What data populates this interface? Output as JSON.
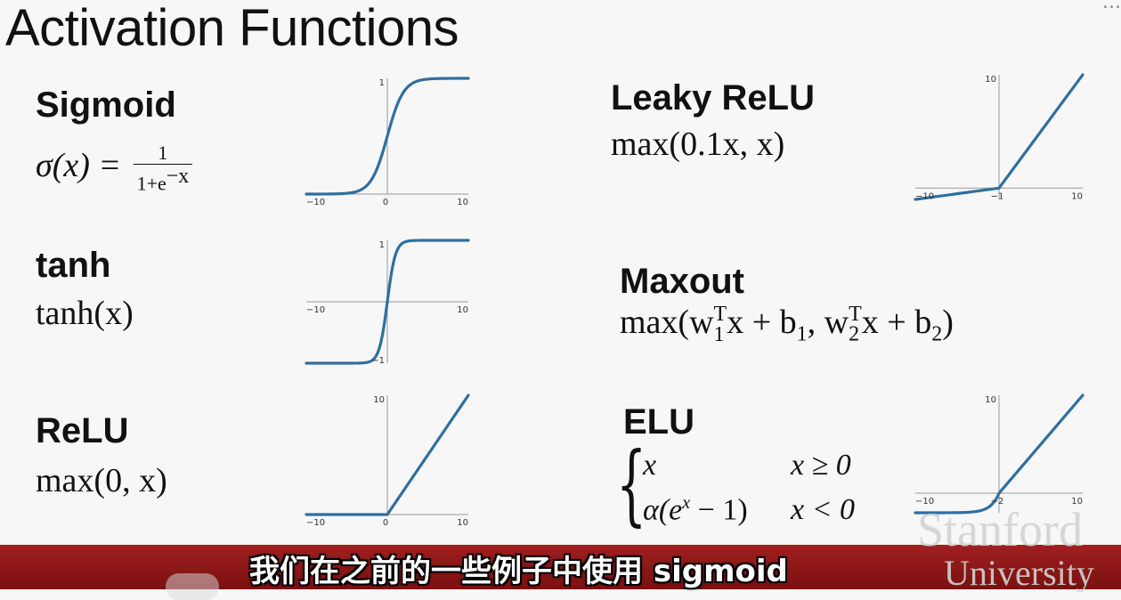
{
  "slide": {
    "title": "Activation Functions",
    "corner_text": "..."
  },
  "functions": {
    "sigmoid": {
      "name": "Sigmoid",
      "lhs": "σ(x) = ",
      "num": "1",
      "den_base": "1+e",
      "den_exp": "−x"
    },
    "tanh": {
      "name": "tanh",
      "formula": "tanh(x)"
    },
    "relu": {
      "name": "ReLU",
      "formula": "max(0, x)"
    },
    "leaky_relu": {
      "name": "Leaky ReLU",
      "formula": "max(0.1x, x)"
    },
    "maxout": {
      "name": "Maxout",
      "p1": "max(w",
      "sub1": "1",
      "sup1": "T",
      "p2": "x + b",
      "sub2": "1",
      "p3": ", w",
      "sub3": "2",
      "sup3": "T",
      "p4": "x + b",
      "sub4": "2",
      "p5": ")"
    },
    "elu": {
      "name": "ELU",
      "row1_expr": "x",
      "row1_cond": "x ≥ 0",
      "row2_expr_a": "α(e",
      "row2_expr_sup": "x",
      "row2_expr_b": " − 1)",
      "row2_cond": "x < 0"
    }
  },
  "chart_data": [
    {
      "type": "line",
      "name": "sigmoid",
      "xlim": [
        -10,
        10
      ],
      "ylim": [
        0,
        1
      ],
      "x_ticks": [
        "−10",
        "0",
        "10"
      ],
      "y_ticks": [
        "1"
      ],
      "function": "sigmoid",
      "color": "#2f6f9f"
    },
    {
      "type": "line",
      "name": "tanh",
      "xlim": [
        -10,
        10
      ],
      "ylim": [
        -1,
        1
      ],
      "x_ticks": [
        "−10",
        "10"
      ],
      "y_ticks": [
        "1",
        "−1"
      ],
      "function": "tanh",
      "color": "#2f6f9f"
    },
    {
      "type": "line",
      "name": "relu",
      "xlim": [
        -10,
        10
      ],
      "ylim": [
        0,
        10
      ],
      "x_ticks": [
        "−10",
        "0",
        "10"
      ],
      "y_ticks": [
        "10"
      ],
      "function": "relu",
      "color": "#2f6f9f"
    },
    {
      "type": "line",
      "name": "leaky_relu",
      "xlim": [
        -10,
        10
      ],
      "ylim": [
        -1,
        10
      ],
      "x_ticks": [
        "−10",
        "−1",
        "10"
      ],
      "y_ticks": [
        "10"
      ],
      "function": "leaky_relu",
      "color": "#2f6f9f"
    },
    {
      "type": "line",
      "name": "elu",
      "xlim": [
        -10,
        10
      ],
      "ylim": [
        -2,
        10
      ],
      "x_ticks": [
        "−10",
        "−2",
        "10"
      ],
      "y_ticks": [
        "10"
      ],
      "function": "elu",
      "color": "#2f6f9f"
    }
  ],
  "subtitle": "我们在之前的一些例子中使用 sigmoid",
  "watermark": {
    "line1": "Stanford",
    "line2": "University"
  }
}
